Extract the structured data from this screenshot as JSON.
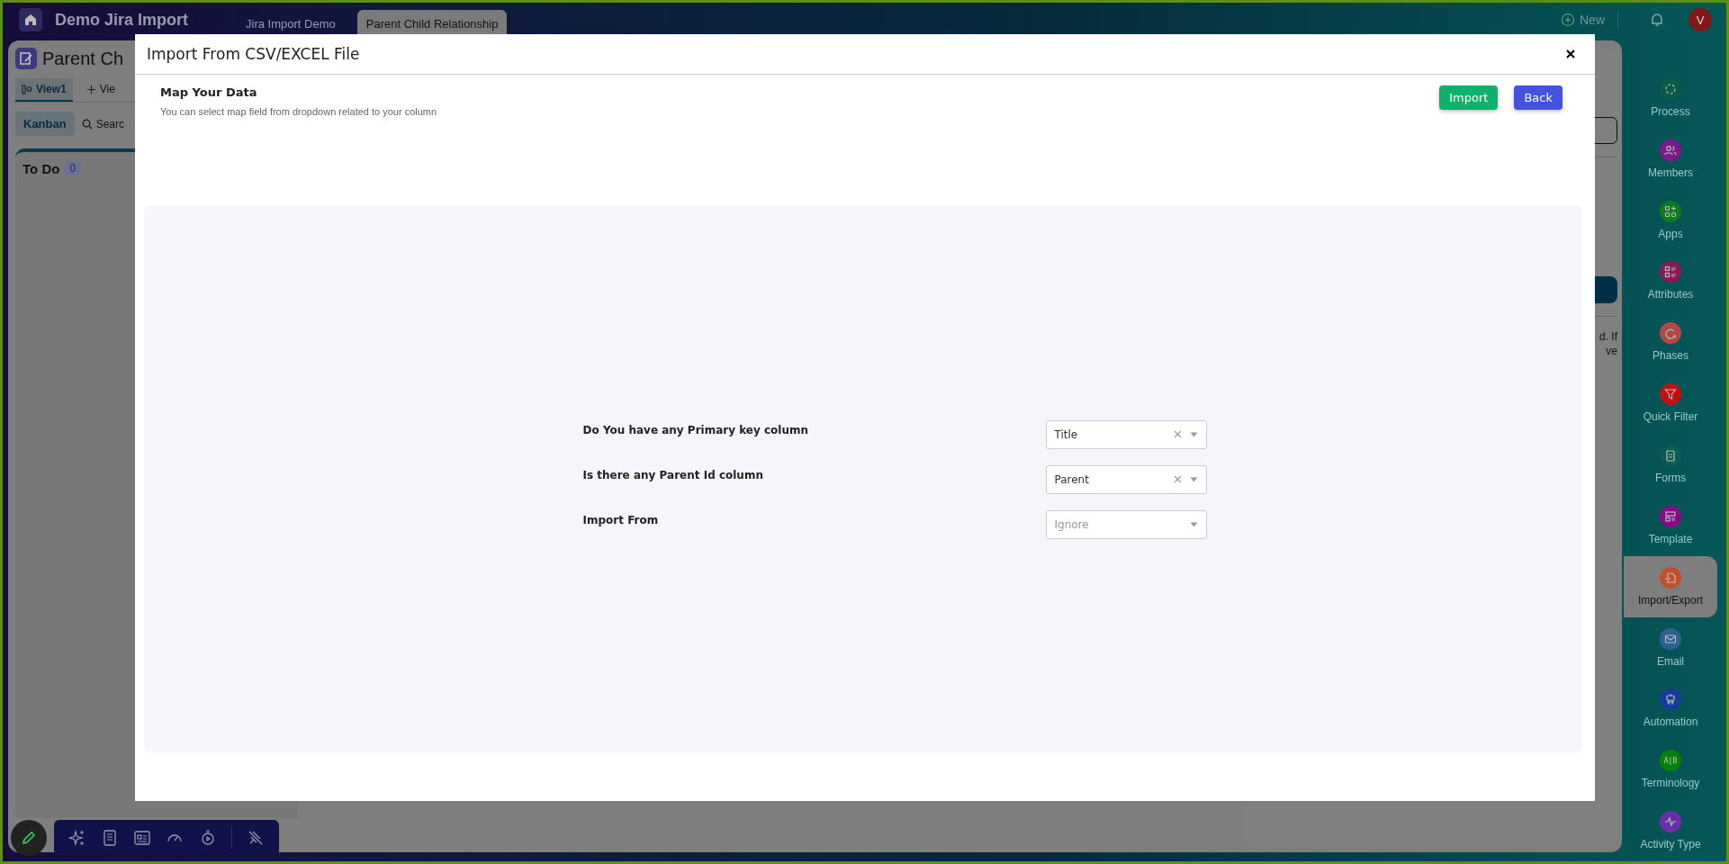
{
  "top_bar": {
    "workspace": "Demo Jira Import",
    "tabs": [
      {
        "label": "Jira Import Demo",
        "selected": false
      },
      {
        "label": "Parent Child Relationship",
        "selected": true
      }
    ],
    "new_button": "New",
    "avatar": "V"
  },
  "board": {
    "title": "Parent Ch",
    "views": [
      {
        "label": "View1",
        "selected": true
      },
      {
        "label": "Vie",
        "selected": false
      }
    ],
    "kanban_button": "Kanban",
    "search_placeholder": "Searc",
    "columns": [
      {
        "title": "To Do",
        "count": "0"
      }
    ],
    "side_texts": [
      "d. If",
      "ve"
    ]
  },
  "sidebar": {
    "items": [
      {
        "label": "Process",
        "color": "#0a5a48",
        "selected": false
      },
      {
        "label": "Members",
        "color": "#7a1a8c",
        "selected": false
      },
      {
        "label": "Apps",
        "color": "#0e7a1e",
        "selected": false
      },
      {
        "label": "Attributes",
        "color": "#8c1a55",
        "selected": false
      },
      {
        "label": "Phases",
        "color": "#b04848",
        "selected": false
      },
      {
        "label": "Quick Filter",
        "color": "#c01010",
        "selected": false
      },
      {
        "label": "Forms",
        "color": "#0a5c50",
        "selected": false
      },
      {
        "label": "Template",
        "color": "#880a88",
        "selected": false
      },
      {
        "label": "Import/Export",
        "color": "#c05030",
        "selected": true
      },
      {
        "label": "Email",
        "color": "#2e6090",
        "selected": false
      },
      {
        "label": "Automation",
        "color": "#1a3a9a",
        "selected": false
      },
      {
        "label": "Terminology",
        "color": "#0a800a",
        "selected": false,
        "icon_text": "A|B"
      },
      {
        "label": "Activity Type",
        "color": "#6a30a8",
        "selected": false
      }
    ]
  },
  "modal": {
    "title": "Import From CSV/EXCEL File",
    "heading": "Map Your Data",
    "subtitle": "You can select map field from dropdown related to your column",
    "buttons": [
      {
        "label": "Import",
        "kind": "primary"
      },
      {
        "label": "Back",
        "kind": "secondary"
      }
    ],
    "fields": [
      {
        "label": "Do You have any Primary key column",
        "value": "Title",
        "clearable": true
      },
      {
        "label": "Is there any Parent Id column",
        "value": "Parent",
        "clearable": true
      },
      {
        "label": "Import From",
        "placeholder": "Ignore",
        "clearable": false
      }
    ]
  }
}
